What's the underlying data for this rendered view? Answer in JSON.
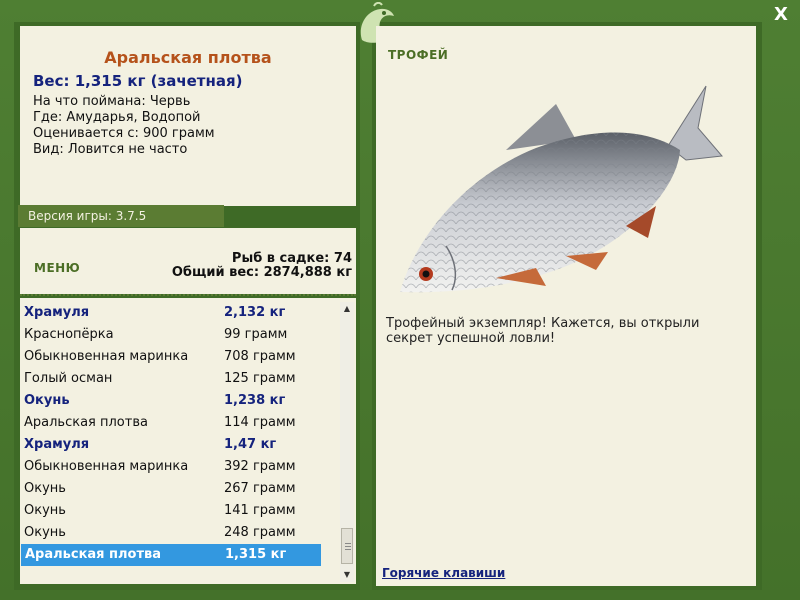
{
  "close_label": "X",
  "fish": {
    "name": "Аральская плотва",
    "weight": "Вес: 1,315 кг (зачетная)",
    "bait": "На что поймана: Червь",
    "where": "Где: Амударья, Водопой",
    "value": "Оценивается с: 900 грамм",
    "kind": "Вид: Ловится не часто"
  },
  "version": "Версия игры: 3.7.5",
  "menu_label": "МЕНЮ",
  "stats": {
    "fish_count": "Рыб в садке: 74",
    "total_weight": "Общий вес: 2874,888 кг"
  },
  "list": [
    {
      "name": "Храмуля",
      "weight": "2,132 кг",
      "trophy": true
    },
    {
      "name": "Краснопёрка",
      "weight": "99 грамм",
      "trophy": false
    },
    {
      "name": "Обыкновенная маринка",
      "weight": "708 грамм",
      "trophy": false
    },
    {
      "name": "Голый осман",
      "weight": "125 грамм",
      "trophy": false
    },
    {
      "name": "Окунь",
      "weight": "1,238 кг",
      "trophy": true
    },
    {
      "name": "Аральская плотва",
      "weight": "114 грамм",
      "trophy": false
    },
    {
      "name": "Храмуля",
      "weight": "1,47 кг",
      "trophy": true
    },
    {
      "name": "Обыкновенная маринка",
      "weight": "392 грамм",
      "trophy": false
    },
    {
      "name": "Окунь",
      "weight": "267 грамм",
      "trophy": false
    },
    {
      "name": "Окунь",
      "weight": "141 грамм",
      "trophy": false
    },
    {
      "name": "Окунь",
      "weight": "248 грамм",
      "trophy": false
    },
    {
      "name": "Аральская плотва",
      "weight": "1,315 кг",
      "trophy": false,
      "selected": true
    }
  ],
  "trophy_label": "ТРОФЕЙ",
  "trophy_text": "Трофейный экземпляр! Кажется, вы открыли секрет успешной ловли!",
  "hotkeys_label": "Горячие клавиши",
  "colors": {
    "frame": "#4a7a2e",
    "panel": "#f3f1e1",
    "title": "#b5521b",
    "trophy_row": "#15237d",
    "selection": "#3398e0"
  },
  "icons": {
    "logo": "fish-logo-icon",
    "close": "close-icon",
    "scroll_up": "scroll-up-icon",
    "scroll_down": "scroll-down-icon"
  }
}
